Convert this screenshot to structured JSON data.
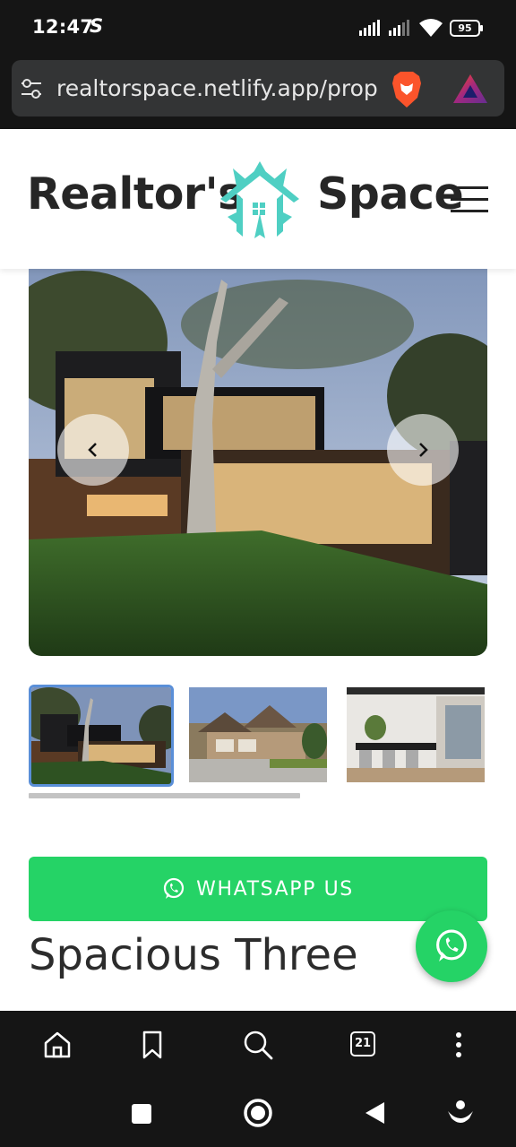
{
  "status_bar": {
    "time": "12:47",
    "extra_icon": "S",
    "battery": "95",
    "icons": [
      "signal-icon",
      "signal-icon",
      "wifi-icon",
      "battery-icon"
    ]
  },
  "browser": {
    "url": "realtorspace.netlify.app/propert",
    "icons": [
      "site-settings-icon",
      "brave-shields-icon",
      "brave-rewards-icon"
    ]
  },
  "header": {
    "brand_left": "Realtor's",
    "brand_right": "Space",
    "icons": [
      "house-logo-icon",
      "hamburger-menu-icon"
    ]
  },
  "carousel": {
    "prev_icon": "chevron-left-icon",
    "next_icon": "chevron-right-icon",
    "thumbnails": [
      "modern-house",
      "suburban-house",
      "dining-interior"
    ],
    "selected_index": 0
  },
  "content": {
    "whatsapp_label": "WHATSAPP US",
    "heading": "Spacious Three"
  },
  "toolbar": {
    "tabs_count": "21",
    "icons": [
      "home-icon",
      "bookmark-icon",
      "search-icon",
      "tabs-icon",
      "more-icon"
    ]
  },
  "nav": {
    "icons": [
      "recents-icon",
      "home-circle-icon",
      "back-icon",
      "assistant-icon"
    ]
  },
  "colors": {
    "accent": "#25d366",
    "logo": "#4fcfc3",
    "selected_thumb_border": "#5a8fd8"
  }
}
